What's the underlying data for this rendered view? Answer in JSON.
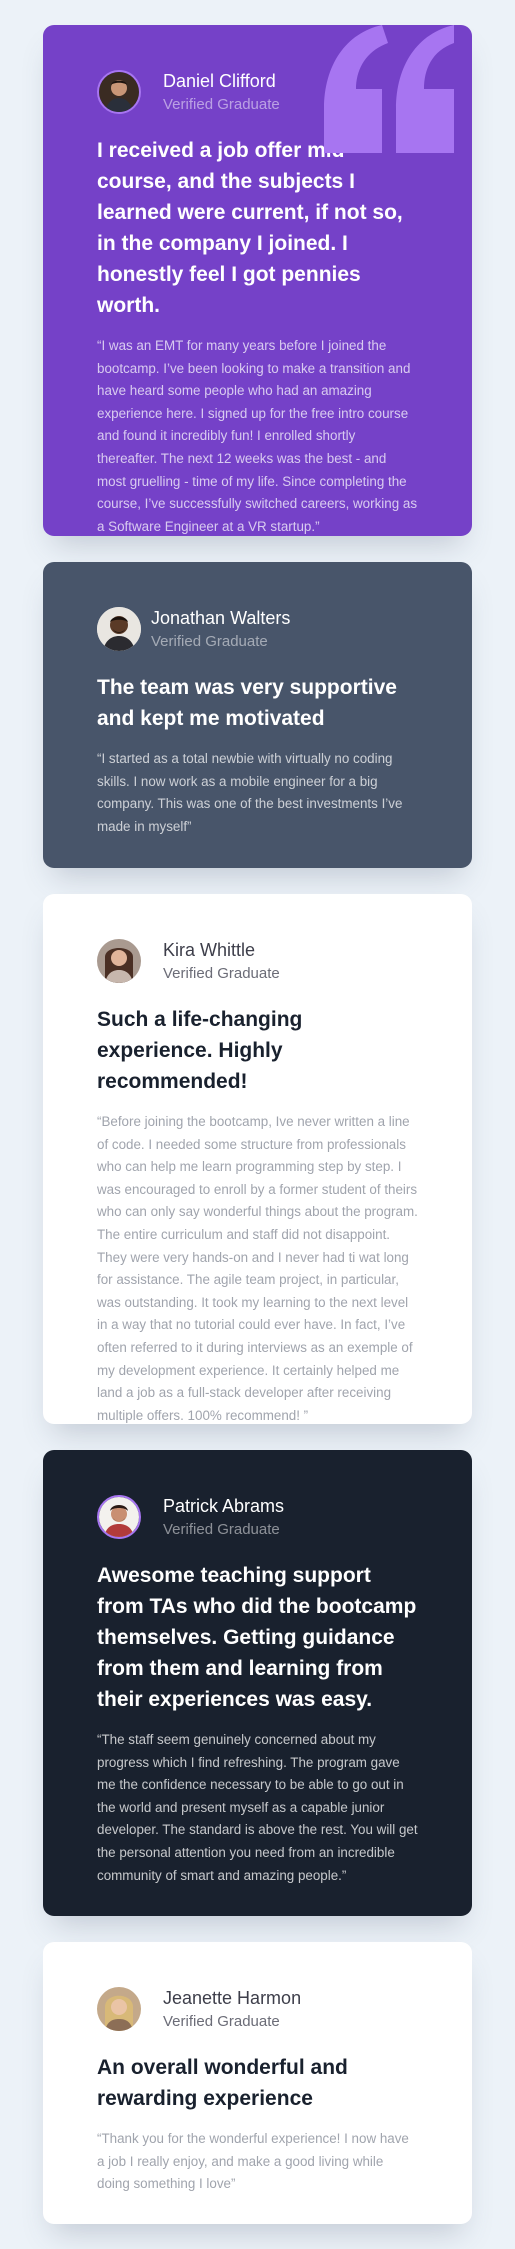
{
  "colors": {
    "background": "#ecf2f8",
    "purple": "#7541c8",
    "gray_blue": "#48556a",
    "white": "#ffffff",
    "dark": "#19212e",
    "quote_mark": "#a775f1"
  },
  "icons": {
    "quote_mark": "quote-mark-icon"
  },
  "testimonials": [
    {
      "name": "Daniel Clifford",
      "status": "Verified Graduate",
      "headline": "I received a job offer mid-course, and the subjects I learned were current, if not so, in the company I joined. I honestly feel I got pennies worth.",
      "body": "“I was an EMT for many years before I joined the bootcamp. I’ve been looking to make a transition and have heard some people who had an amazing experience here. I signed up for the free intro course and found it incredibly fun! I enrolled shortly thereafter. The next 12 weeks was the best - and most gruelling - time of my life. Since completing the course, I’ve successfully switched careers, working as a Software Engineer at a VR startup.”"
    },
    {
      "name": "Jonathan Walters",
      "status": "Verified Graduate",
      "headline": "The team was very supportive and kept me motivated",
      "body": "“I started as a total newbie with virtually no coding skills. I now work as a mobile engineer for a big company. This was one of the best investments I’ve made in myself”"
    },
    {
      "name": "Kira Whittle",
      "status": "Verified Graduate",
      "headline": "Such a life-changing experience. Highly recommended!",
      "body": "“Before joining the bootcamp, Ive never written a line of code. I needed some structure from professionals who can help me learn programming step by step. I was encouraged to enroll by a former student of theirs who can only say wonderful things about the program. The entire curriculum and staff did not disappoint. They were very hands-on and I never had ti wat long for assistance. The agile team project, in particular, was outstanding. It took my learning to the next level in a way that no tutorial could ever have. In fact, I’ve often referred to it during interviews as an exemple of my development experience. It certainly helped me land a job as a full-stack developer after receiving multiple offers. 100% recommend! ”"
    },
    {
      "name": "Patrick Abrams",
      "status": "Verified Graduate",
      "headline": "Awesome teaching support from TAs who did the bootcamp themselves. Getting guidance from them and learning from their experiences was easy.",
      "body": "“The staff seem genuinely concerned about my progress which I find refreshing. The program gave me the confidence necessary to be able to go out in the world and present myself as a capable junior developer. The standard is above the rest. You will get the personal attention you need from an incredible community of smart and amazing people.”"
    },
    {
      "name": "Jeanette Harmon",
      "status": "Verified Graduate",
      "headline": "An overall wonderful and rewarding experience",
      "body": "“Thank you for the wonderful experience! I now have a job I really enjoy, and make a good living while doing something I love”"
    }
  ]
}
